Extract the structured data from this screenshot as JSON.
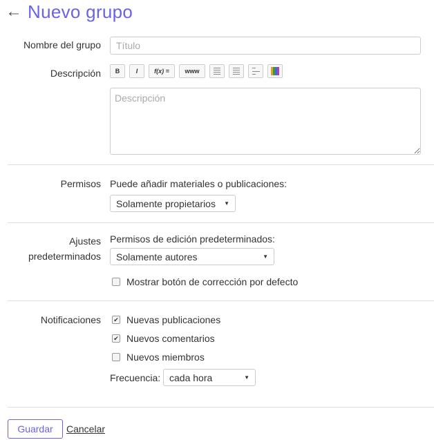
{
  "header": {
    "title": "Nuevo grupo",
    "back_icon": "arrow-left-icon"
  },
  "name_field": {
    "label": "Nombre del grupo",
    "placeholder": "Título",
    "value": ""
  },
  "description": {
    "label": "Descripción",
    "placeholder": "Descripción",
    "toolbar": [
      {
        "name": "bold",
        "text": "B",
        "icon": "bold-icon"
      },
      {
        "name": "italic",
        "text": "I",
        "icon": "italic-icon"
      },
      {
        "name": "formula",
        "text": "f(x) =",
        "icon": "formula-icon"
      },
      {
        "name": "link",
        "text": "www",
        "icon": "link-icon"
      },
      {
        "name": "bullet-list",
        "icon": "bullet-list-icon"
      },
      {
        "name": "numbered-list",
        "icon": "numbered-list-icon"
      },
      {
        "name": "indent",
        "icon": "indent-icon"
      },
      {
        "name": "color",
        "icon": "color-palette-icon"
      }
    ]
  },
  "permissions": {
    "label": "Permisos",
    "question": "Puede añadir materiales o publicaciones:",
    "selected": "Solamente propietarios"
  },
  "defaults": {
    "label_line1": "Ajustes",
    "label_line2": "predeterminados",
    "question": "Permisos de edición predeterminados:",
    "selected": "Solamente autores",
    "checkbox_label": "Mostrar botón de corrección por defecto",
    "checkbox_checked": false
  },
  "notifications": {
    "label": "Notificaciones",
    "options": [
      {
        "label": "Nuevas publicaciones",
        "checked": true
      },
      {
        "label": "Nuevos comentarios",
        "checked": true
      },
      {
        "label": "Nuevos miembros",
        "checked": false
      }
    ],
    "frequency_label": "Frecuencia:",
    "frequency_selected": "cada hora"
  },
  "actions": {
    "save": "Guardar",
    "cancel": "Cancelar"
  },
  "colors": {
    "accent": "#6b63e6",
    "divider": "#dddddd"
  }
}
